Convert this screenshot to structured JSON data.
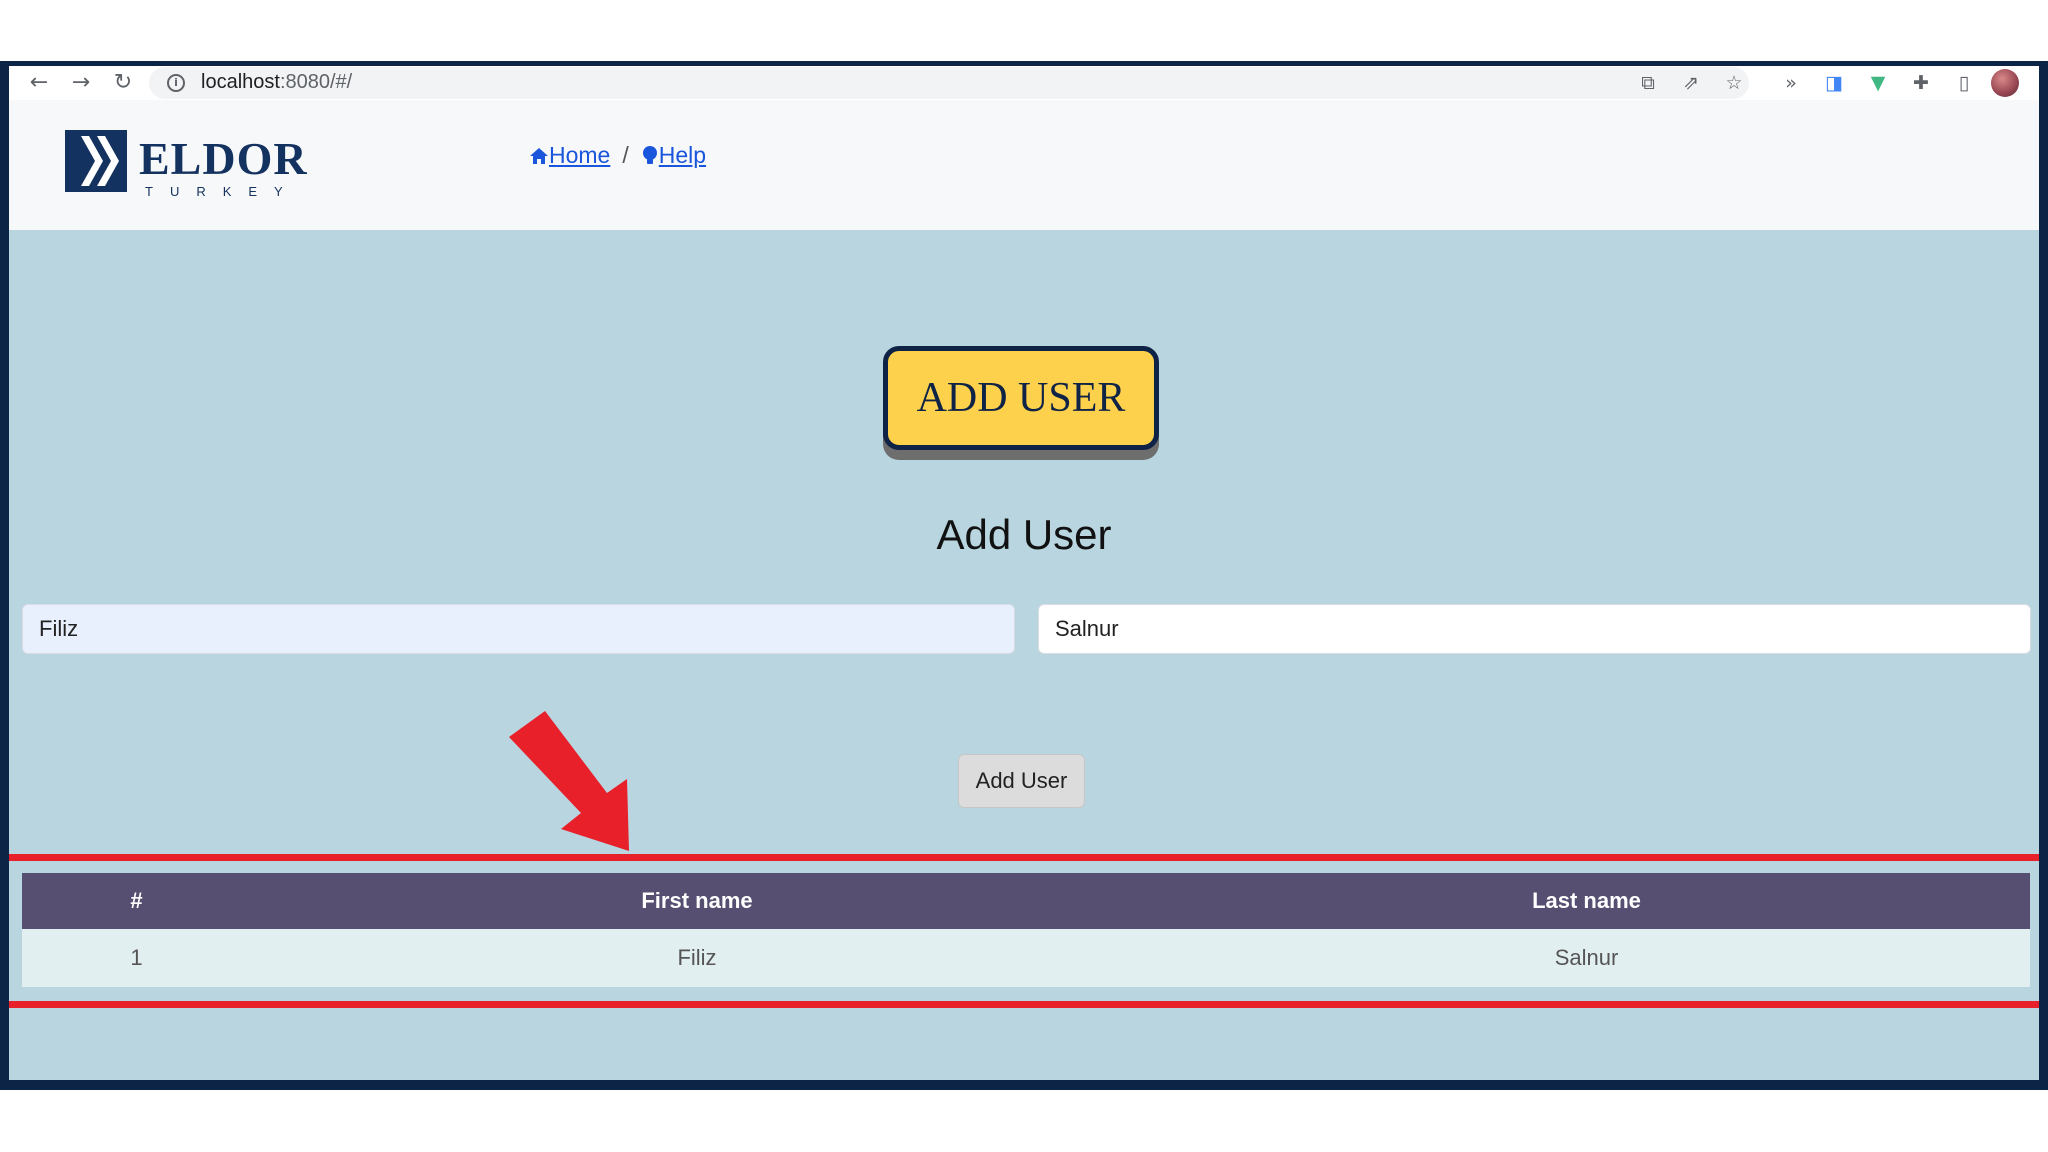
{
  "browser": {
    "url_host": "localhost",
    "url_rest": ":8080/#/"
  },
  "header": {
    "logo_word": "ELDOR",
    "logo_sub": "TURKEY",
    "breadcrumb": [
      {
        "label": "Home"
      },
      {
        "separator": "/"
      },
      {
        "label": "Help"
      }
    ]
  },
  "hero_button": {
    "label": "ADD USER"
  },
  "form": {
    "title": "Add User",
    "first_name_value": "Filiz",
    "last_name_value": "Salnur",
    "submit_label": "Add User"
  },
  "table": {
    "headers": [
      "#",
      "First name",
      "Last name"
    ],
    "rows": [
      [
        "1",
        "Filiz",
        "Salnur"
      ]
    ]
  },
  "colors": {
    "frame": "#0c2547",
    "background": "#b8d5e0",
    "hero_button": "#fdd14b",
    "table_header": "#564f72",
    "highlight": "#e8202a"
  }
}
